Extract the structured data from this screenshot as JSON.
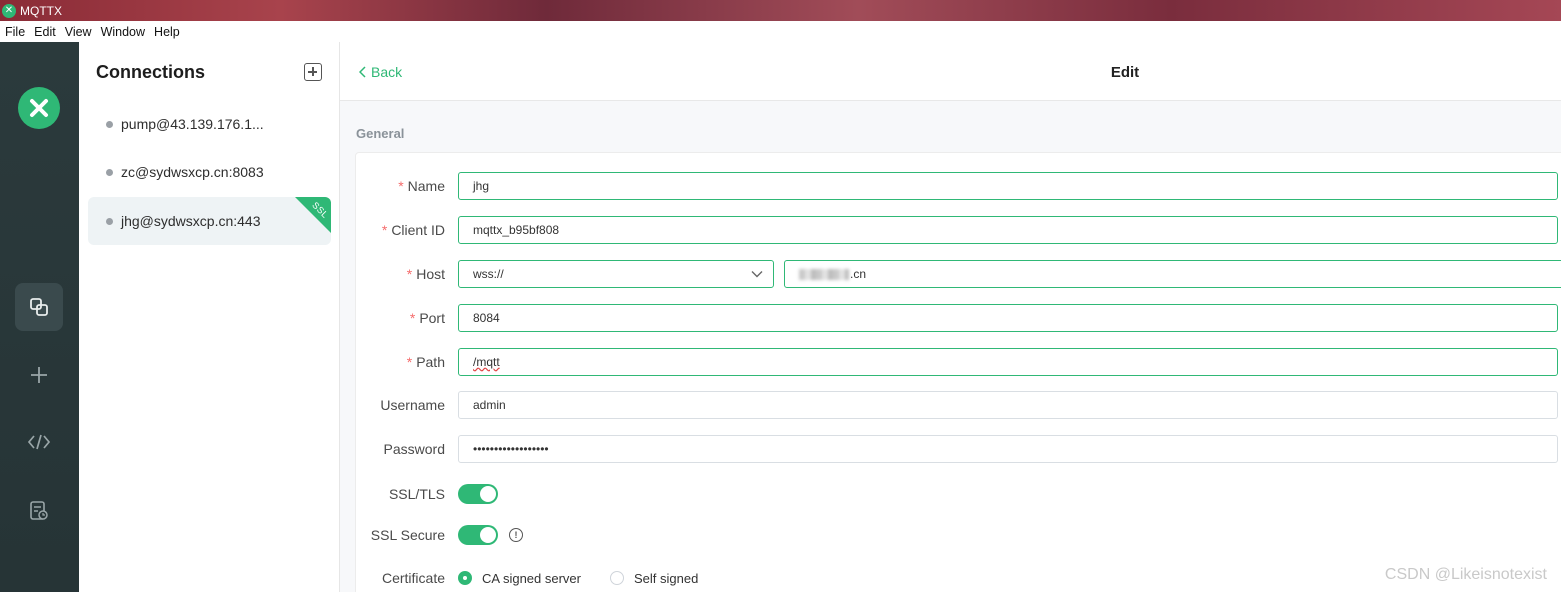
{
  "window": {
    "title": "MQTTX"
  },
  "menu": [
    "File",
    "Edit",
    "View",
    "Window",
    "Help"
  ],
  "connections": {
    "title": "Connections",
    "items": [
      {
        "label": "pump@43.139.176.1...",
        "selected": false,
        "ssl": false
      },
      {
        "label": "zc@sydwsxcp.cn:8083",
        "selected": false,
        "ssl": false
      },
      {
        "label": "jhg@sydwsxcp.cn:443",
        "selected": true,
        "ssl": true
      }
    ],
    "ssl_badge": "SSL"
  },
  "header": {
    "back_label": "Back",
    "title": "Edit"
  },
  "general": {
    "section_label": "General",
    "name": {
      "label": "Name",
      "value": "jhg"
    },
    "client_id": {
      "label": "Client ID",
      "value": "mqttx_b95bf808"
    },
    "host": {
      "label": "Host",
      "protocol": "wss://",
      "value_suffix": ".cn"
    },
    "port": {
      "label": "Port",
      "value": "8084"
    },
    "path": {
      "label": "Path",
      "value": "/mqtt"
    },
    "username": {
      "label": "Username",
      "value": "admin"
    },
    "password": {
      "label": "Password",
      "value": "••••••••••••••••••"
    },
    "ssl_tls": {
      "label": "SSL/TLS",
      "on": true
    },
    "ssl_secure": {
      "label": "SSL Secure",
      "on": true
    },
    "certificate": {
      "label": "Certificate",
      "options": [
        "CA signed server",
        "Self signed"
      ],
      "selected": "CA signed server"
    }
  },
  "required_marker": "*",
  "watermark": "CSDN @Likeisnotexist",
  "colors": {
    "accent": "#2fb876",
    "nav_bg": "#2b3a3c",
    "required": "#f56c6c"
  }
}
